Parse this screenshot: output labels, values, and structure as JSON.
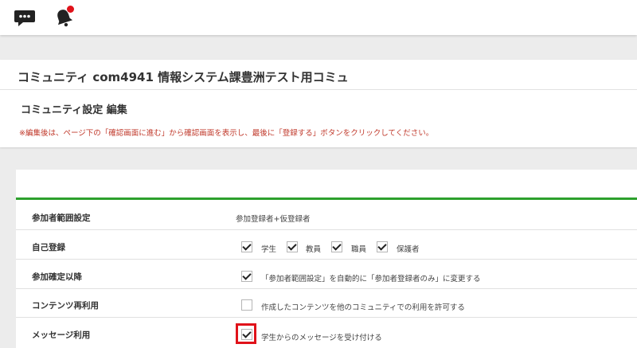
{
  "topbar": {
    "chat_icon": "chat-bubble-icon",
    "bell_icon": "bell-icon",
    "notification_color": "#e0121a"
  },
  "header": {
    "community_title": "コミュニティ com4941 情報システム課豊洲テスト用コミュ",
    "section_title": "コミュニティ設定 編集",
    "note": "※編集後は、ページ下の「確認画面に進む」から確認画面を表示し、最後に「登録する」ボタンをクリックしてください。"
  },
  "form": {
    "accent_color": "#2ca02c",
    "rows": [
      {
        "label": "参加者範囲設定",
        "value": "参加登録者+仮登録者"
      },
      {
        "label": "自己登録",
        "options": [
          {
            "label": "学生",
            "checked": true
          },
          {
            "label": "教員",
            "checked": true
          },
          {
            "label": "職員",
            "checked": true
          },
          {
            "label": "保護者",
            "checked": true
          }
        ]
      },
      {
        "label": "参加確定以降",
        "option": {
          "label": "「参加者範囲設定」を自動的に「参加者登録者のみ」に変更する",
          "checked": true
        }
      },
      {
        "label": "コンテンツ再利用",
        "option": {
          "label": "作成したコンテンツを他のコミュニティでの利用を許可する",
          "checked": false
        }
      },
      {
        "label": "メッセージ利用",
        "option": {
          "label": "学生からのメッセージを受け付ける",
          "checked": true
        }
      }
    ]
  }
}
